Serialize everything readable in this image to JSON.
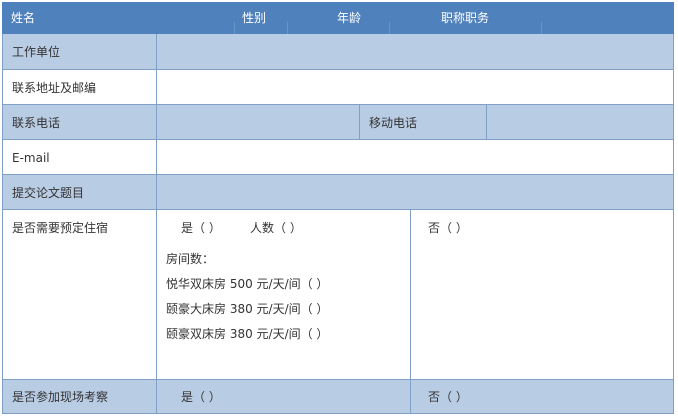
{
  "header": {
    "name": "姓名",
    "gender": "性别",
    "age": "年龄",
    "title": "职称职务"
  },
  "rows": {
    "work_unit": "工作单位",
    "address": "联系地址及邮编",
    "phone": "联系电话",
    "mobile": "移动电话",
    "email": "E-mail",
    "paper_title": "提交论文题目",
    "lodging": {
      "label": "是否需要预定住宿",
      "yes": "是（   ）",
      "people": "人数（ ）",
      "rooms_label": "房间数：",
      "room1": "悦华双床房 500 元/天/间（   ）",
      "room2": "颐豪大床房 380 元/天/间（   ）",
      "room3": "颐豪双床房 380 元/天/间（   ）",
      "no": "否（   ）"
    },
    "visit": {
      "label": "是否参加现场考察",
      "yes": "是（   ）",
      "no": "否（   ）"
    }
  },
  "colors": {
    "header_bg": "#4f81bd",
    "shade_bg": "#b8cce4",
    "border": "#7f9fc6"
  }
}
